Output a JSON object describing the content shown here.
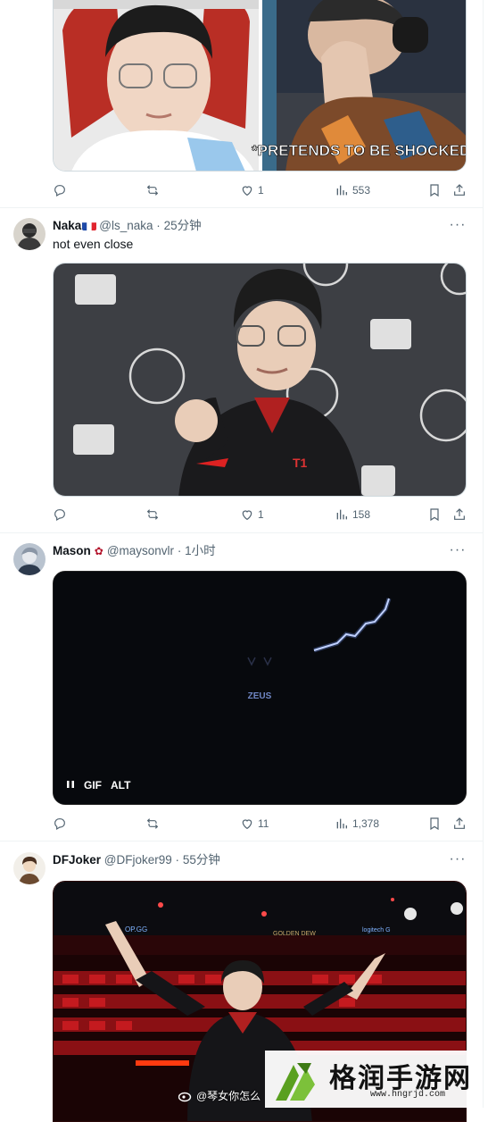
{
  "tweets": [
    {
      "media_caption": "*PRETENDS TO BE SHOCKED*",
      "actions": {
        "reply": "",
        "retweet": "",
        "like": "1",
        "views": "553"
      }
    },
    {
      "name": "Naka",
      "handle": "@ls_naka",
      "dot": "·",
      "time": "25分钟",
      "text": "not even close",
      "actions": {
        "reply": "",
        "retweet": "",
        "like": "1",
        "views": "158"
      }
    },
    {
      "name": "Mason",
      "handle": "@maysonvlr",
      "dot": "·",
      "time": "1小时",
      "media_text": "ZEUS",
      "gif_label": "GIF",
      "alt_label": "ALT",
      "actions": {
        "reply": "",
        "retweet": "",
        "like": "11",
        "views": "1,378"
      }
    },
    {
      "name": "DFJoker",
      "handle": "@DFjoker99",
      "dot": "·",
      "time": "55分钟",
      "stage_signs": [
        "OP.GG",
        "GOLDEN DEW",
        "logitech G"
      ]
    }
  ],
  "watermark": {
    "title": "格润手游网",
    "url": "www.hngrjd.com",
    "weibo_tag": "@琴女你怎么"
  },
  "colors": {
    "text_primary": "#0f1419",
    "text_secondary": "#536471",
    "divider": "#eff3f4",
    "logo_green": "#5aa020"
  },
  "icons": [
    "reply-icon",
    "retweet-icon",
    "heart-icon",
    "views-icon",
    "bookmark-icon",
    "share-icon",
    "more-icon",
    "pause-icon",
    "weibo-icon"
  ]
}
